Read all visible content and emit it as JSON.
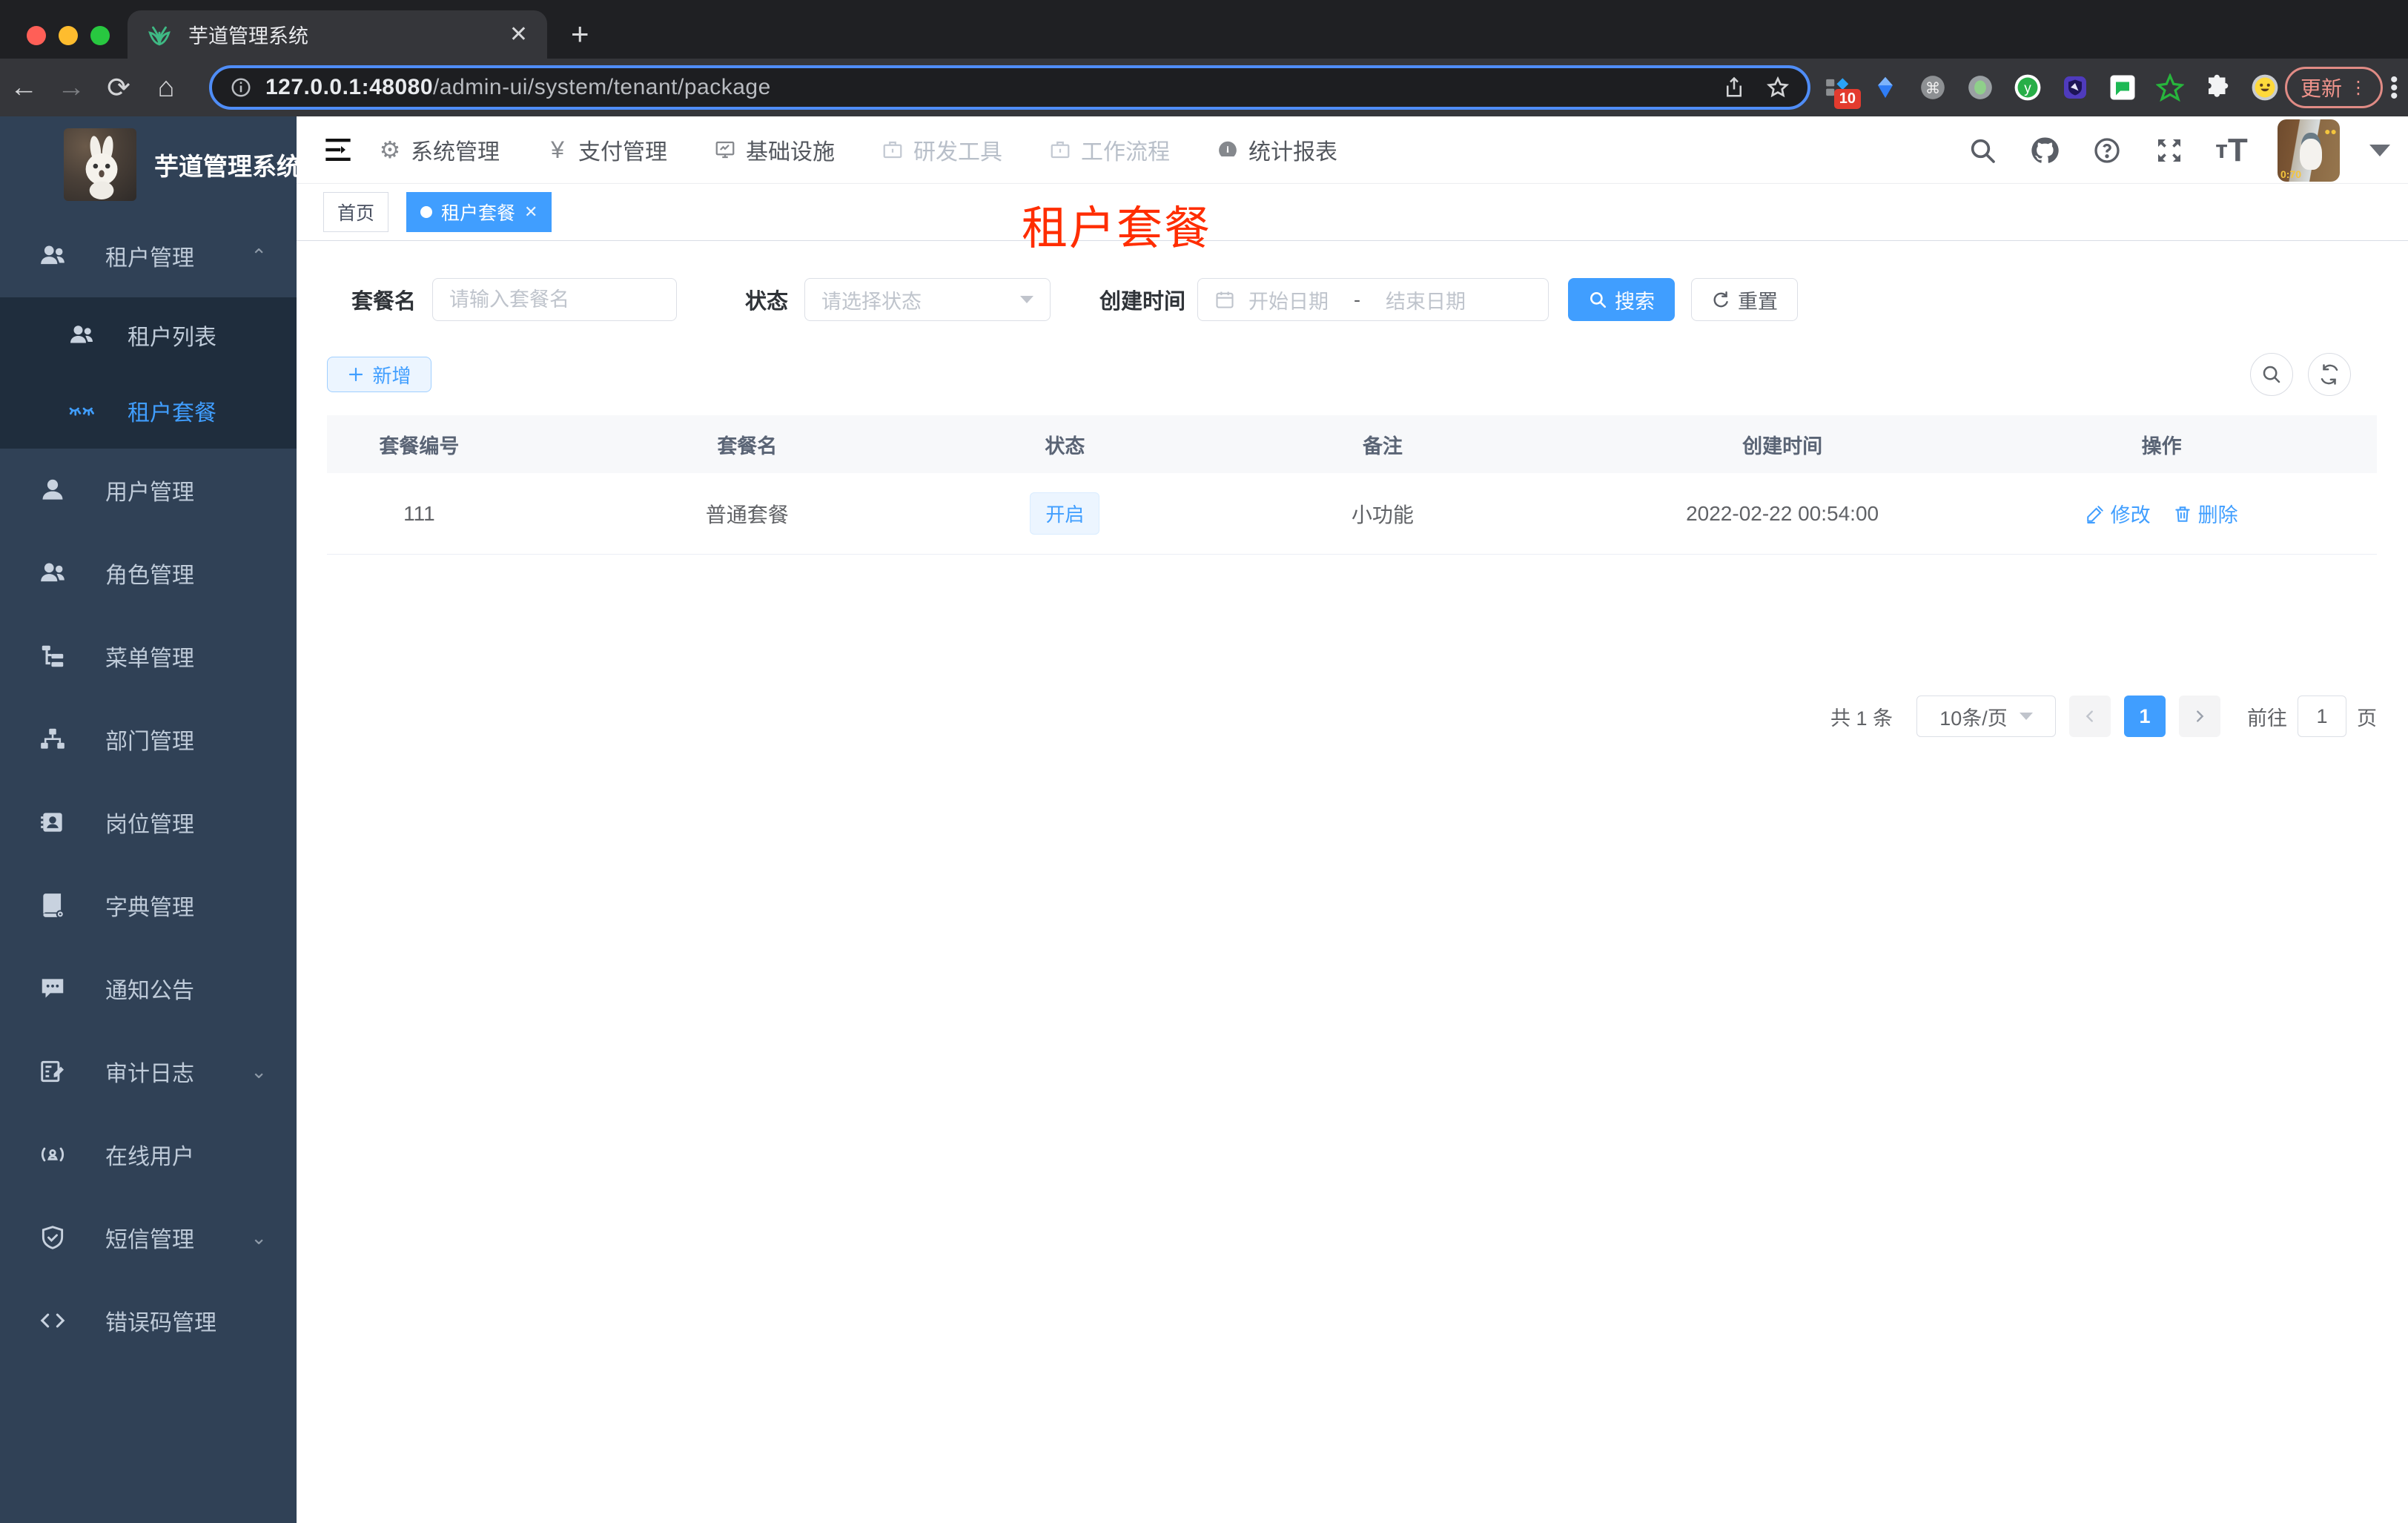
{
  "browser": {
    "tab_title": "芋道管理系统",
    "url_host": "127.0.0.1:48080",
    "url_path": "/admin-ui/system/tenant/package",
    "update_label": "更新",
    "extension_badge": "10",
    "close_glyph": "✕",
    "newtab_glyph": "+"
  },
  "colors": {
    "accent": "#409eff",
    "sidebar": "#304156",
    "submenu": "#1f2d3d",
    "red_title": "#ff2d00"
  },
  "sidebar": {
    "app_title": "芋道管理系统",
    "items": [
      {
        "label": "租户管理"
      },
      {
        "label": "租户列表"
      },
      {
        "label": "租户套餐"
      },
      {
        "label": "用户管理"
      },
      {
        "label": "角色管理"
      },
      {
        "label": "菜单管理"
      },
      {
        "label": "部门管理"
      },
      {
        "label": "岗位管理"
      },
      {
        "label": "字典管理"
      },
      {
        "label": "通知公告"
      },
      {
        "label": "审计日志"
      },
      {
        "label": "在线用户"
      },
      {
        "label": "短信管理"
      },
      {
        "label": "错误码管理"
      }
    ]
  },
  "navbar": {
    "menus": [
      {
        "label": "系统管理"
      },
      {
        "label": "支付管理"
      },
      {
        "label": "基础设施"
      },
      {
        "label": "研发工具"
      },
      {
        "label": "工作流程"
      },
      {
        "label": "统计报表"
      }
    ],
    "yen_glyph": "¥"
  },
  "tags": {
    "home": "首页",
    "current": "租户套餐"
  },
  "page": {
    "red_title": "租户套餐"
  },
  "filters": {
    "name_label": "套餐名",
    "name_placeholder": "请输入套餐名",
    "status_label": "状态",
    "status_placeholder": "请选择状态",
    "created_label": "创建时间",
    "date_start": "开始日期",
    "date_separator": "-",
    "date_end": "结束日期",
    "search_label": "搜索",
    "reset_label": "重置"
  },
  "toolbar": {
    "add_label": "新增"
  },
  "table": {
    "columns": [
      "套餐编号",
      "套餐名",
      "状态",
      "备注",
      "创建时间",
      "操作"
    ],
    "rows": [
      {
        "id": "111",
        "name": "普通套餐",
        "status": "开启",
        "remark": "小功能",
        "created": "2022-02-22 00:54:00"
      }
    ],
    "edit_label": "修改",
    "delete_label": "删除"
  },
  "pagination": {
    "total": "共 1 条",
    "page_size": "10条/页",
    "current": "1",
    "goto_label": "前往",
    "goto_value": "1",
    "page_unit": "页"
  }
}
